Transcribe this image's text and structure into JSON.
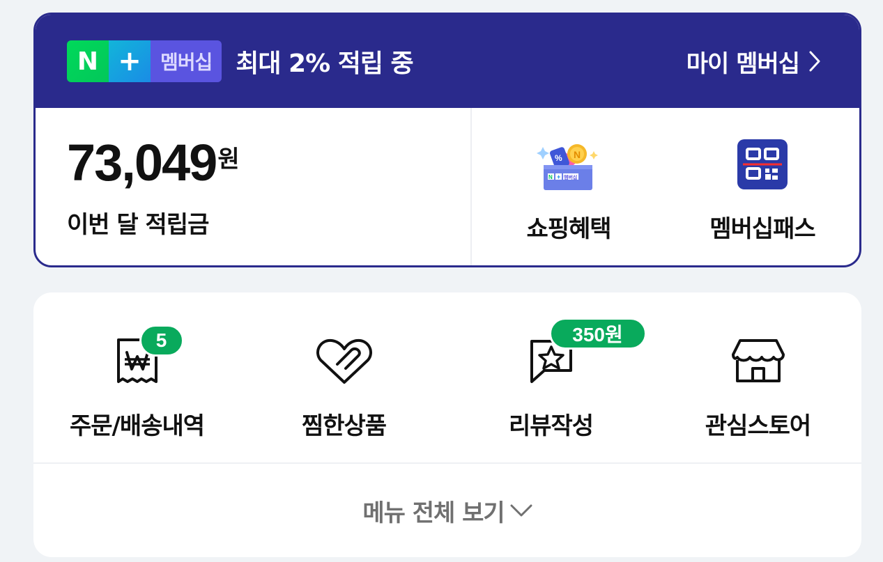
{
  "membership": {
    "badge": {
      "n": "N",
      "plus": "+",
      "text": "멤버십"
    },
    "header_text": "최대 2% 적립 중",
    "my_link": "마이 멤버십",
    "points_value": "73,049",
    "points_unit": "원",
    "points_label": "이번 달 적립금",
    "quick_items": [
      {
        "label": "쇼핑혜택",
        "icon": "shopping-benefit-icon"
      },
      {
        "label": "멤버십패스",
        "icon": "qr-code-icon"
      }
    ],
    "mini_badge": {
      "n": "N",
      "plus": "+",
      "text": "멤버십"
    },
    "colors": {
      "header_bg": "#2a2a8c",
      "green": "#03c75a"
    }
  },
  "menu": {
    "items": [
      {
        "label": "주문/배송내역",
        "icon": "receipt-won-icon",
        "badge": "5"
      },
      {
        "label": "찜한상품",
        "icon": "heart-icon"
      },
      {
        "label": "리뷰작성",
        "icon": "review-star-icon",
        "badge": "350원"
      },
      {
        "label": "관심스토어",
        "icon": "store-icon"
      }
    ],
    "more_label": "메뉴 전체 보기",
    "colors": {
      "badge": "#09aa5c"
    }
  }
}
